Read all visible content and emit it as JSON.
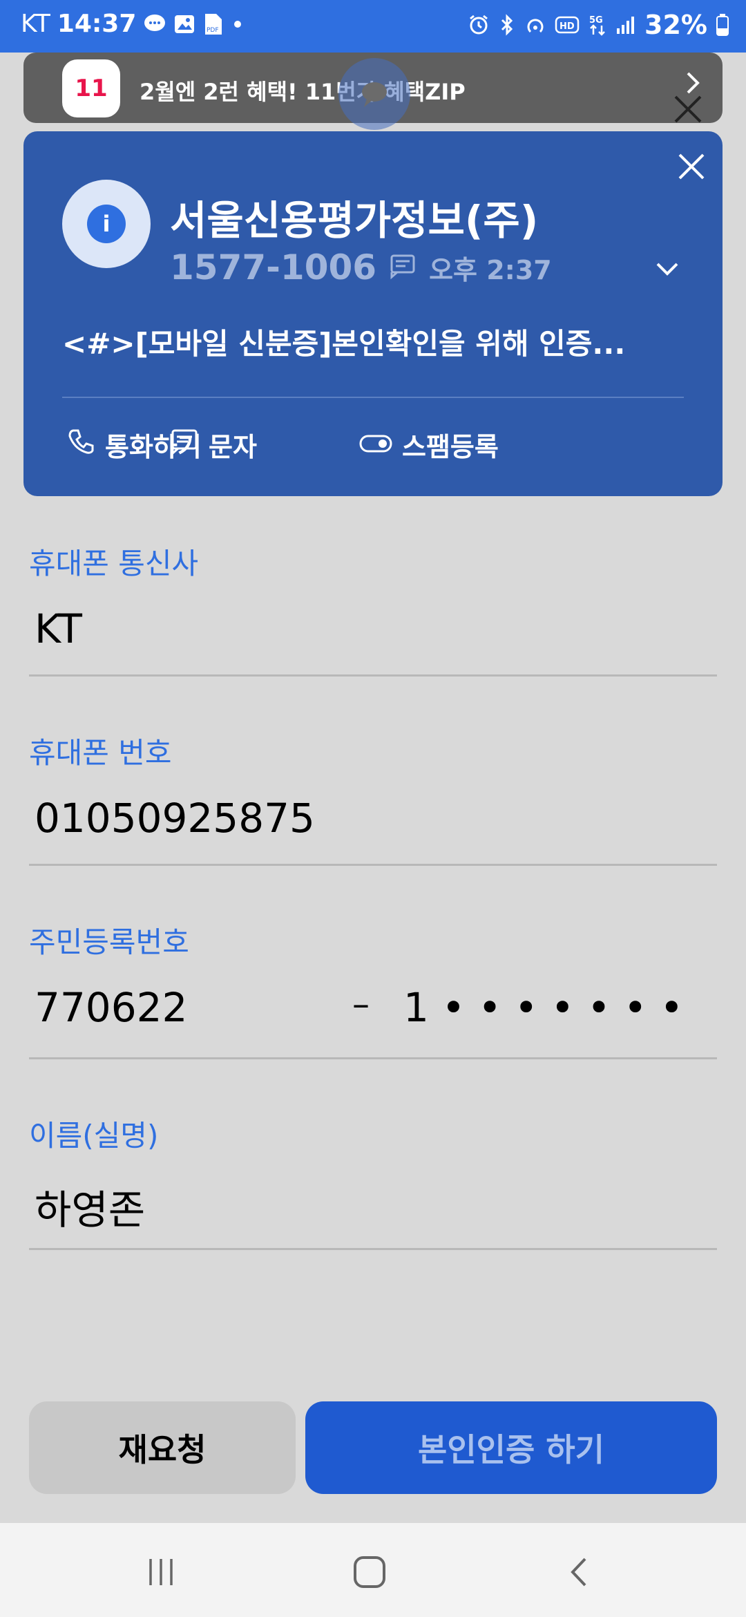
{
  "status_bar": {
    "carrier": "KT",
    "time": "14:37",
    "battery": "32%",
    "icons_left": [
      "chat-icon",
      "gallery-icon",
      "pdf-icon",
      "dot-icon"
    ],
    "icons_right": [
      "alarm-icon",
      "bluetooth-icon",
      "hotspot-icon",
      "hd-icon",
      "5g-icon",
      "signal-icon",
      "battery-icon"
    ]
  },
  "promo_banner": {
    "logo": "11",
    "text": "2월엔 2런 혜택! 11번가 혜택ZIP"
  },
  "caller_card": {
    "name": "서울신용평가정보(주)",
    "number": "1577-1006",
    "time": "오후 2:37",
    "message": "<#>[모바일 신분증]본인확인을 위해 인증...",
    "actions": {
      "call": "통화하기",
      "message": "문자",
      "spam": "스팸등록"
    }
  },
  "form": {
    "carrier_label": "휴대폰 통신사",
    "carrier_value": "KT",
    "phone_label": "휴대폰 번호",
    "phone_value": "01050925875",
    "rrn_label": "주민등록번호",
    "rrn_front": "770622",
    "rrn_dash": "–",
    "rrn_back": "1 • • • • • • •",
    "name_label": "이름(실명)",
    "name_value": "하영존"
  },
  "buttons": {
    "reissue": "재요청",
    "verify": "본인인증 하기"
  },
  "colors": {
    "accent": "#2f6fe0",
    "card": "#2f5aaa",
    "primary_button": "#1f5ad0"
  }
}
